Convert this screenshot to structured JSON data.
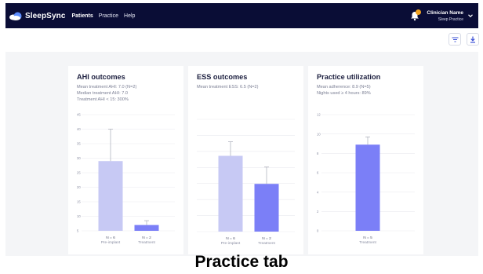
{
  "app": {
    "brand": "SleepSync",
    "nav": [
      "Patients",
      "Practice",
      "Help"
    ],
    "active_nav": "Patients",
    "user_name": "Clinician Name",
    "user_role": "Sleep Practice"
  },
  "colors": {
    "navbar": "#0a0d36",
    "pre_bar": "#c7c9f4",
    "treat_bar": "#7b7ff7",
    "notification": "#f2a321"
  },
  "icons": [
    "brand-logo-icon",
    "bell-icon",
    "chevron-down-icon",
    "filter-icon",
    "download-icon"
  ],
  "cards": [
    {
      "title": "AHI outcomes",
      "stats": [
        "Mean treatment AHI: 7.0 (N=2)",
        "Median treatment AHI: 7.0",
        "Treatment AHI < 15: 300%"
      ]
    },
    {
      "title": "ESS outcomes",
      "stats": [
        "Mean treatment ESS: 6.5 (N=2)"
      ]
    },
    {
      "title": "Practice utilization",
      "stats": [
        "Mean adherence: 8.9 (N=5)",
        "Nights used ≥ 4 hours: 89%"
      ]
    }
  ],
  "caption": "Practice tab",
  "chart_data": [
    {
      "type": "bar",
      "categories": [
        "Pre-implant",
        "Treatment"
      ],
      "n_labels": [
        "N = 6",
        "N = 2"
      ],
      "values": [
        29,
        7
      ],
      "error_high": [
        40,
        8.5
      ],
      "ylim": [
        5,
        45
      ],
      "yticks": [
        5,
        10,
        15,
        20,
        25,
        30,
        35,
        40,
        45
      ],
      "colors": [
        "#c7c9f4",
        "#7b7ff7"
      ],
      "grid": true
    },
    {
      "type": "bar",
      "categories": [
        "Pre-implant",
        "Treatment"
      ],
      "n_labels": [
        "N = 6",
        "N = 2"
      ],
      "values": [
        13.5,
        8.5
      ],
      "error_high": [
        16,
        11.5
      ],
      "ylim": [
        0,
        20
      ],
      "yticks": [],
      "colors": [
        "#c7c9f4",
        "#7b7ff7"
      ],
      "grid": true
    },
    {
      "type": "bar",
      "categories": [
        "Treatment"
      ],
      "n_labels": [
        "N = 5"
      ],
      "values": [
        8.9
      ],
      "error_high": [
        9.7
      ],
      "ylim": [
        0,
        12
      ],
      "yticks": [
        0,
        2,
        4,
        6,
        8,
        10,
        12
      ],
      "colors": [
        "#7b7ff7"
      ],
      "grid": true
    }
  ]
}
